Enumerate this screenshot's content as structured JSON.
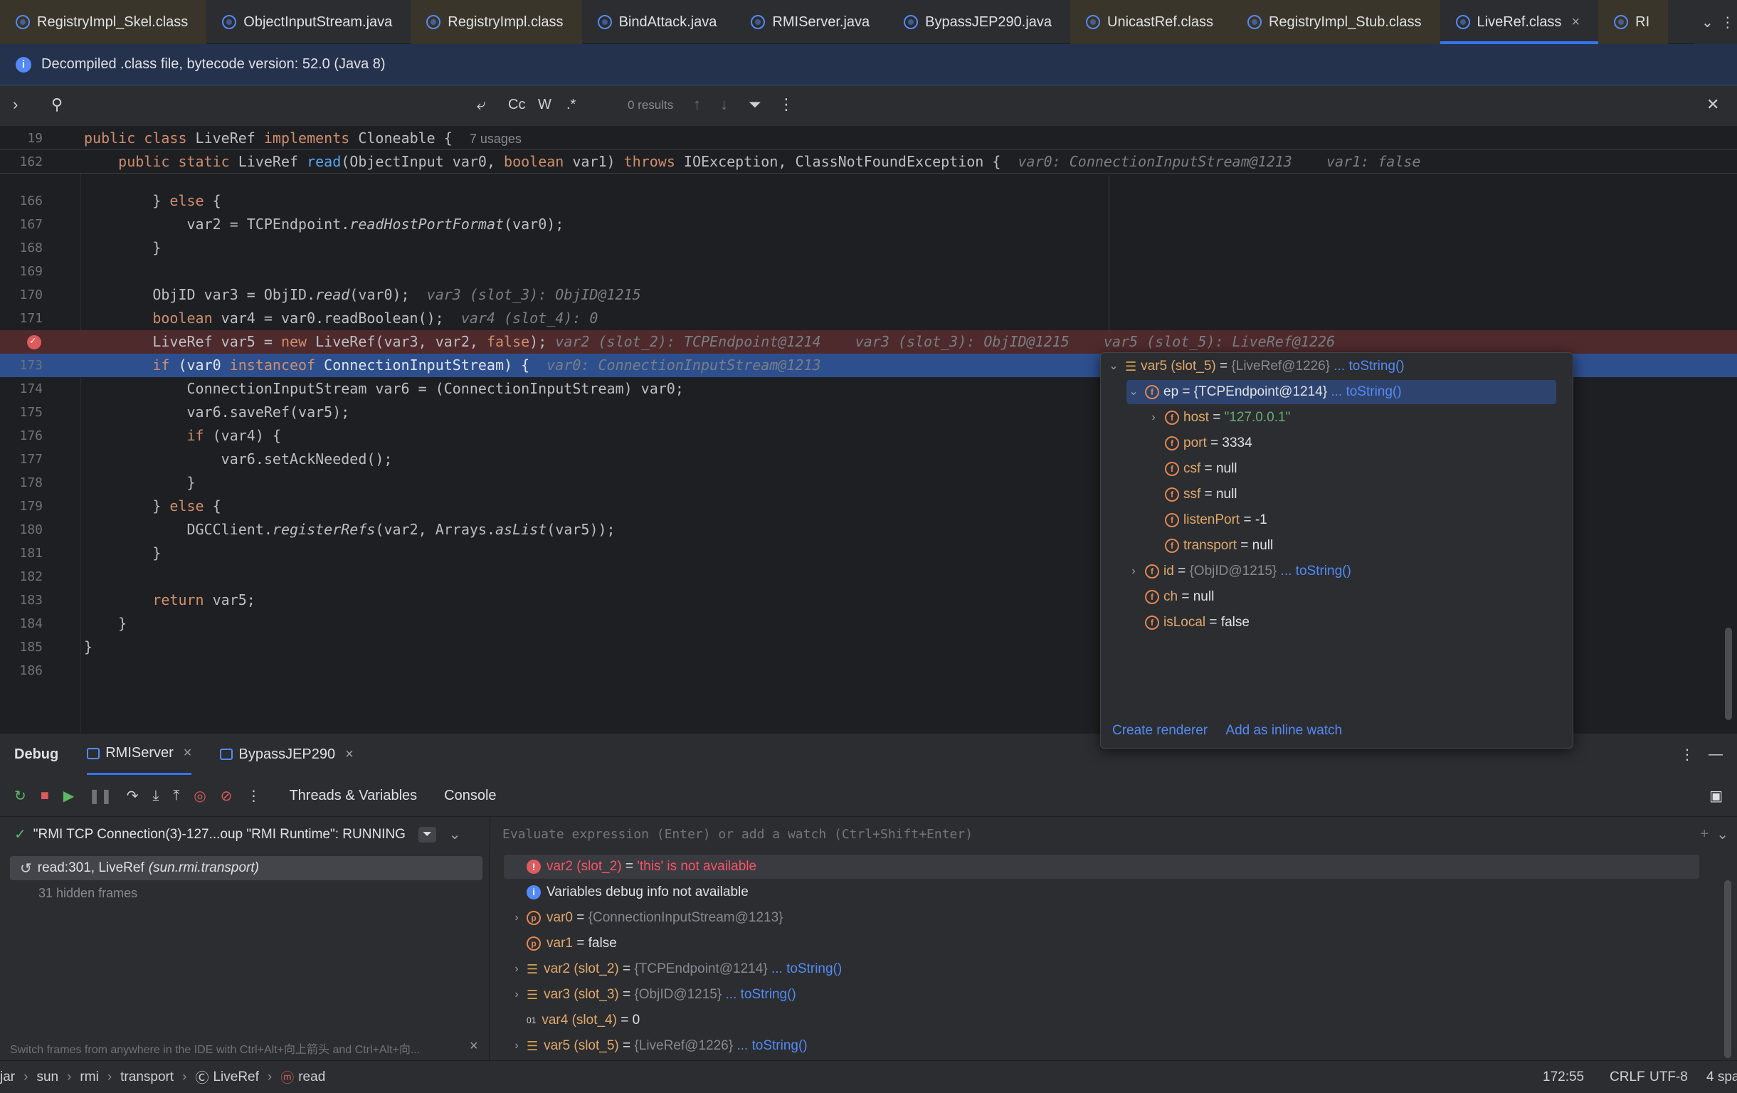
{
  "tabs": [
    {
      "label": "RegistryImpl_Skel.class",
      "kind": "class"
    },
    {
      "label": "ObjectInputStream.java",
      "kind": "java"
    },
    {
      "label": "RegistryImpl.class",
      "kind": "class"
    },
    {
      "label": "BindAttack.java",
      "kind": "java"
    },
    {
      "label": "RMIServer.java",
      "kind": "java"
    },
    {
      "label": "BypassJEP290.java",
      "kind": "java"
    },
    {
      "label": "UnicastRef.class",
      "kind": "class"
    },
    {
      "label": "RegistryImpl_Stub.class",
      "kind": "class"
    },
    {
      "label": "LiveRef.class",
      "kind": "class",
      "active": true
    },
    {
      "label": "RI",
      "kind": "class"
    }
  ],
  "banner": {
    "text": "Decompiled .class file, bytecode version: 52.0 (Java 8)"
  },
  "find": {
    "results": "0 results",
    "opts": [
      "Cc",
      "W",
      ".*"
    ]
  },
  "sticky": [
    {
      "ln": "19",
      "parts": [
        [
          "kw",
          "public class "
        ],
        [
          "",
          "LiveRef "
        ],
        [
          "kw",
          "implements "
        ],
        [
          "",
          "Cloneable {  "
        ],
        [
          "dimu",
          "7 usages"
        ]
      ]
    },
    {
      "ln": "162",
      "parts": [
        [
          "",
          "    "
        ],
        [
          "kw",
          "public static "
        ],
        [
          "",
          "LiveRef "
        ],
        [
          "fn",
          "read"
        ],
        [
          "",
          "(ObjectInput var0, "
        ],
        [
          "kw",
          "boolean "
        ],
        [
          "",
          "var1) "
        ],
        [
          "kw",
          "throws "
        ],
        [
          "",
          "IOException, ClassNotFoundException {  "
        ],
        [
          "hint",
          "var0: ConnectionInputStream@1213    var1: false"
        ]
      ]
    }
  ],
  "code": [
    {
      "ln": "166",
      "parts": [
        [
          "",
          "        } "
        ],
        [
          "kw",
          "else "
        ],
        [
          "",
          "{"
        ]
      ]
    },
    {
      "ln": "167",
      "parts": [
        [
          "",
          "            var2 = TCPEndpoint."
        ],
        [
          "it",
          "readHostPortFormat"
        ],
        [
          "",
          "(var0);"
        ]
      ]
    },
    {
      "ln": "168",
      "parts": [
        [
          "",
          "        }"
        ]
      ]
    },
    {
      "ln": "169",
      "parts": [
        [
          "",
          ""
        ]
      ]
    },
    {
      "ln": "170",
      "parts": [
        [
          "",
          "        ObjID var3 = ObjID."
        ],
        [
          "it",
          "read"
        ],
        [
          "",
          "(var0);  "
        ],
        [
          "hint",
          "var3 (slot_3): ObjID@1215"
        ]
      ]
    },
    {
      "ln": "171",
      "parts": [
        [
          "",
          "        "
        ],
        [
          "kw",
          "boolean "
        ],
        [
          "",
          "var4 = var0.readBoolean();  "
        ],
        [
          "hint",
          "var4 (slot_4): 0"
        ]
      ]
    },
    {
      "ln": "",
      "bp": true,
      "parts": [
        [
          "",
          "        LiveRef var5 = "
        ],
        [
          "kw",
          "new "
        ],
        [
          "",
          "LiveRef(var3, var2, "
        ],
        [
          "kw",
          "false"
        ],
        [
          "",
          "); "
        ],
        [
          "hint",
          "var2 (slot_2): TCPEndpoint@1214    var3 (slot_3): ObjID@1215    var5 (slot_5): LiveRef@1226"
        ]
      ]
    },
    {
      "ln": "173",
      "cur": true,
      "parts": [
        [
          "",
          "        "
        ],
        [
          "kw",
          "if "
        ],
        [
          "",
          "(var0 "
        ],
        [
          "kw",
          "instanceof "
        ],
        [
          "",
          "ConnectionInputStream) {  "
        ],
        [
          "hint",
          "var0: ConnectionInputStream@1213"
        ]
      ]
    },
    {
      "ln": "174",
      "parts": [
        [
          "",
          "            ConnectionInputStream var6 = (ConnectionInputStream) var0;"
        ]
      ]
    },
    {
      "ln": "175",
      "parts": [
        [
          "",
          "            var6.saveRef(var5);"
        ]
      ]
    },
    {
      "ln": "176",
      "parts": [
        [
          "",
          "            "
        ],
        [
          "kw",
          "if "
        ],
        [
          "",
          "(var4) {"
        ]
      ]
    },
    {
      "ln": "177",
      "parts": [
        [
          "",
          "                var6.setAckNeeded();"
        ]
      ]
    },
    {
      "ln": "178",
      "parts": [
        [
          "",
          "            }"
        ]
      ]
    },
    {
      "ln": "179",
      "parts": [
        [
          "",
          "        } "
        ],
        [
          "kw",
          "else "
        ],
        [
          "",
          "{"
        ]
      ]
    },
    {
      "ln": "180",
      "parts": [
        [
          "",
          "            DGCClient."
        ],
        [
          "it",
          "registerRefs"
        ],
        [
          "",
          "(var2, Arrays."
        ],
        [
          "it",
          "asList"
        ],
        [
          "",
          "(var5));"
        ]
      ]
    },
    {
      "ln": "181",
      "parts": [
        [
          "",
          "        }"
        ]
      ]
    },
    {
      "ln": "182",
      "parts": [
        [
          "",
          ""
        ]
      ]
    },
    {
      "ln": "183",
      "parts": [
        [
          "",
          "        "
        ],
        [
          "kw",
          "return "
        ],
        [
          "",
          "var5;"
        ]
      ]
    },
    {
      "ln": "184",
      "parts": [
        [
          "",
          "    }"
        ]
      ]
    },
    {
      "ln": "185",
      "parts": [
        [
          "",
          "}"
        ]
      ]
    },
    {
      "ln": "186",
      "parts": [
        [
          "",
          ""
        ]
      ]
    }
  ],
  "popup": {
    "rows": [
      {
        "indent": 0,
        "chev": "⌄",
        "icon": "stack",
        "name": "var5 (slot_5)",
        "eq": " = ",
        "dim": "{LiveRef@1226}",
        "link": " ... toString()"
      },
      {
        "indent": 1,
        "chev": "⌄",
        "icon": "field-lock",
        "name": "ep",
        "eq": " = ",
        "val": "{TCPEndpoint@1214}",
        "link": " ... toString()",
        "sel": true
      },
      {
        "indent": 2,
        "chev": "›",
        "icon": "field",
        "name": "host",
        "eq": " = ",
        "str": "\"127.0.0.1\""
      },
      {
        "indent": 2,
        "chev": "",
        "icon": "field",
        "name": "port",
        "eq": " = ",
        "val": "3334"
      },
      {
        "indent": 2,
        "chev": "",
        "icon": "field-lock",
        "name": "csf",
        "eq": " = ",
        "val": "null"
      },
      {
        "indent": 2,
        "chev": "",
        "icon": "field-lock",
        "name": "ssf",
        "eq": " = ",
        "val": "null"
      },
      {
        "indent": 2,
        "chev": "",
        "icon": "field",
        "name": "listenPort",
        "eq": " = ",
        "val": "-1"
      },
      {
        "indent": 2,
        "chev": "",
        "icon": "field",
        "name": "transport",
        "eq": " = ",
        "val": "null"
      },
      {
        "indent": 1,
        "chev": "›",
        "icon": "field-lock",
        "name": "id",
        "eq": " = ",
        "dim": "{ObjID@1215}",
        "link": " ... toString()"
      },
      {
        "indent": 1,
        "chev": "",
        "icon": "field",
        "name": "ch",
        "eq": " = ",
        "val": "null"
      },
      {
        "indent": 1,
        "chev": "",
        "icon": "field-lock",
        "name": "isLocal",
        "eq": " = ",
        "val": "false"
      }
    ],
    "create_renderer": "Create renderer",
    "add_inline_watch": "Add as inline watch"
  },
  "debug": {
    "title": "Debug",
    "sessions": [
      "RMIServer",
      "BypassJEP290"
    ],
    "subtabs": [
      "Threads & Variables",
      "Console"
    ],
    "thread": "\"RMI TCP Connection(3)-127...oup \"RMI Runtime\": RUNNING",
    "eval_placeholder": "Evaluate expression (Enter) or add a watch (Ctrl+Shift+Enter)",
    "frame": "read:301, LiveRef",
    "frame_pkg": "(sun.rmi.transport)",
    "hidden": "31 hidden frames",
    "tip": "Switch frames from anywhere in the IDE with Ctrl+Alt+向上箭头 and Ctrl+Alt+向...",
    "vars": [
      {
        "chev": "",
        "icon": "error",
        "name": "var2 (slot_2)",
        "eq": " = ",
        "err": "'this' is not available"
      },
      {
        "chev": "",
        "icon": "info",
        "name": "Variables debug info not available"
      },
      {
        "chev": "›",
        "icon": "param",
        "name": "var0",
        "eq": " = ",
        "dim": "{ConnectionInputStream@1213}"
      },
      {
        "chev": "",
        "icon": "param",
        "name": "var1",
        "eq": " = ",
        "val": "false"
      },
      {
        "chev": "›",
        "icon": "stack",
        "name": "var2 (slot_2)",
        "eq": " = ",
        "dim": "{TCPEndpoint@1214}",
        "link": " ... toString()"
      },
      {
        "chev": "›",
        "icon": "stack",
        "name": "var3 (slot_3)",
        "eq": " = ",
        "dim": "{ObjID@1215}",
        "link": " ... toString()"
      },
      {
        "chev": "",
        "icon": "num",
        "name": "var4 (slot_4)",
        "eq": " = ",
        "val": "0"
      },
      {
        "chev": "›",
        "icon": "stack",
        "name": "var5 (slot_5)",
        "eq": " = ",
        "dim": "{LiveRef@1226}",
        "link": " ... toString()"
      }
    ]
  },
  "status": {
    "crumbs": [
      "jar",
      "sun",
      "rmi",
      "transport",
      "LiveRef",
      "read"
    ],
    "pos": "172:55",
    "eol": "CRLF",
    "enc": "UTF-8",
    "indent": "4 spa"
  }
}
